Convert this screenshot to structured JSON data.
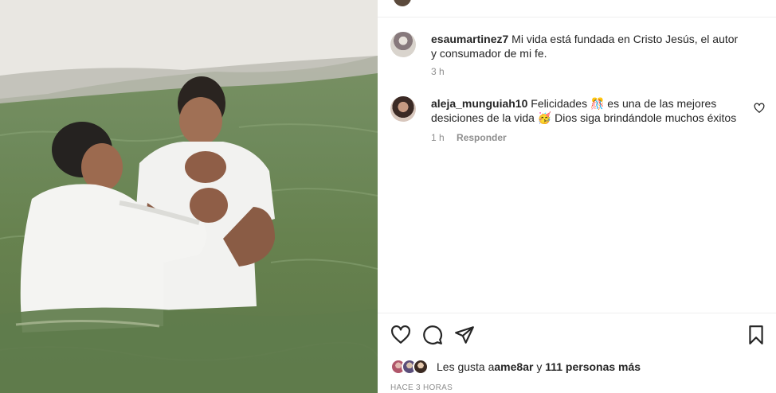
{
  "photo": {
    "alt_icon": "baptism-photo",
    "water_color": "#6f8a5c"
  },
  "comments": [
    {
      "username": "esaumartinez7",
      "text": "Mi vida está fundada en Cristo Jesús, el autor y consumador de mi fe.",
      "time": "3 h"
    },
    {
      "username": "aleja_munguiah10",
      "text": "Felicidades 🎊 es una de las mejores desiciones de la vida 🥳 Dios siga brindándole muchos éxitos",
      "time": "1 h",
      "reply_label": "Responder"
    }
  ],
  "likes": {
    "prefix": "Les gusta a ",
    "first_user": "ame8ar",
    "middle": " y ",
    "others": "111 personas más"
  },
  "posted": "Hace 3 horas",
  "colors": {
    "text": "#262626",
    "muted": "#8e8e8e",
    "divider": "#efefef"
  }
}
